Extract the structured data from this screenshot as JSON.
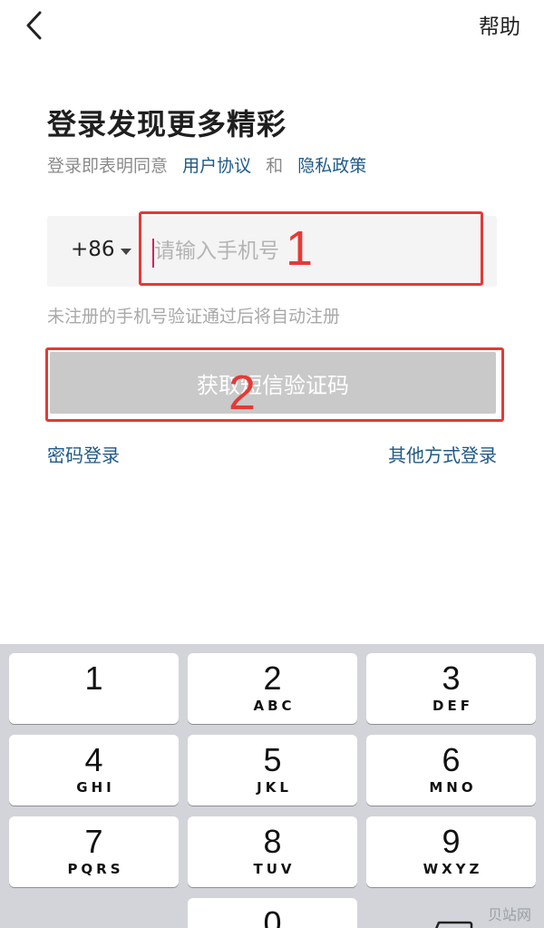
{
  "header": {
    "help": "帮助"
  },
  "login": {
    "title": "登录发现更多精彩",
    "agree_prefix": "登录即表明同意",
    "user_agreement": "用户协议",
    "and": "和",
    "privacy_policy": "隐私政策",
    "country_code": "+86",
    "phone_placeholder": "请输入手机号",
    "hint": "未注册的手机号验证通过后将自动注册",
    "sms_button": "获取短信验证码",
    "password_login": "密码登录",
    "other_login": "其他方式登录"
  },
  "annotations": {
    "step1": "1",
    "step2": "2"
  },
  "keyboard": {
    "keys": [
      {
        "digit": "1",
        "letters": ""
      },
      {
        "digit": "2",
        "letters": "ABC"
      },
      {
        "digit": "3",
        "letters": "DEF"
      },
      {
        "digit": "4",
        "letters": "GHI"
      },
      {
        "digit": "5",
        "letters": "JKL"
      },
      {
        "digit": "6",
        "letters": "MNO"
      },
      {
        "digit": "7",
        "letters": "PQRS"
      },
      {
        "digit": "8",
        "letters": "TUV"
      },
      {
        "digit": "9",
        "letters": "WXYZ"
      },
      {
        "digit": "0",
        "letters": ""
      }
    ]
  },
  "watermark": "贝站网"
}
